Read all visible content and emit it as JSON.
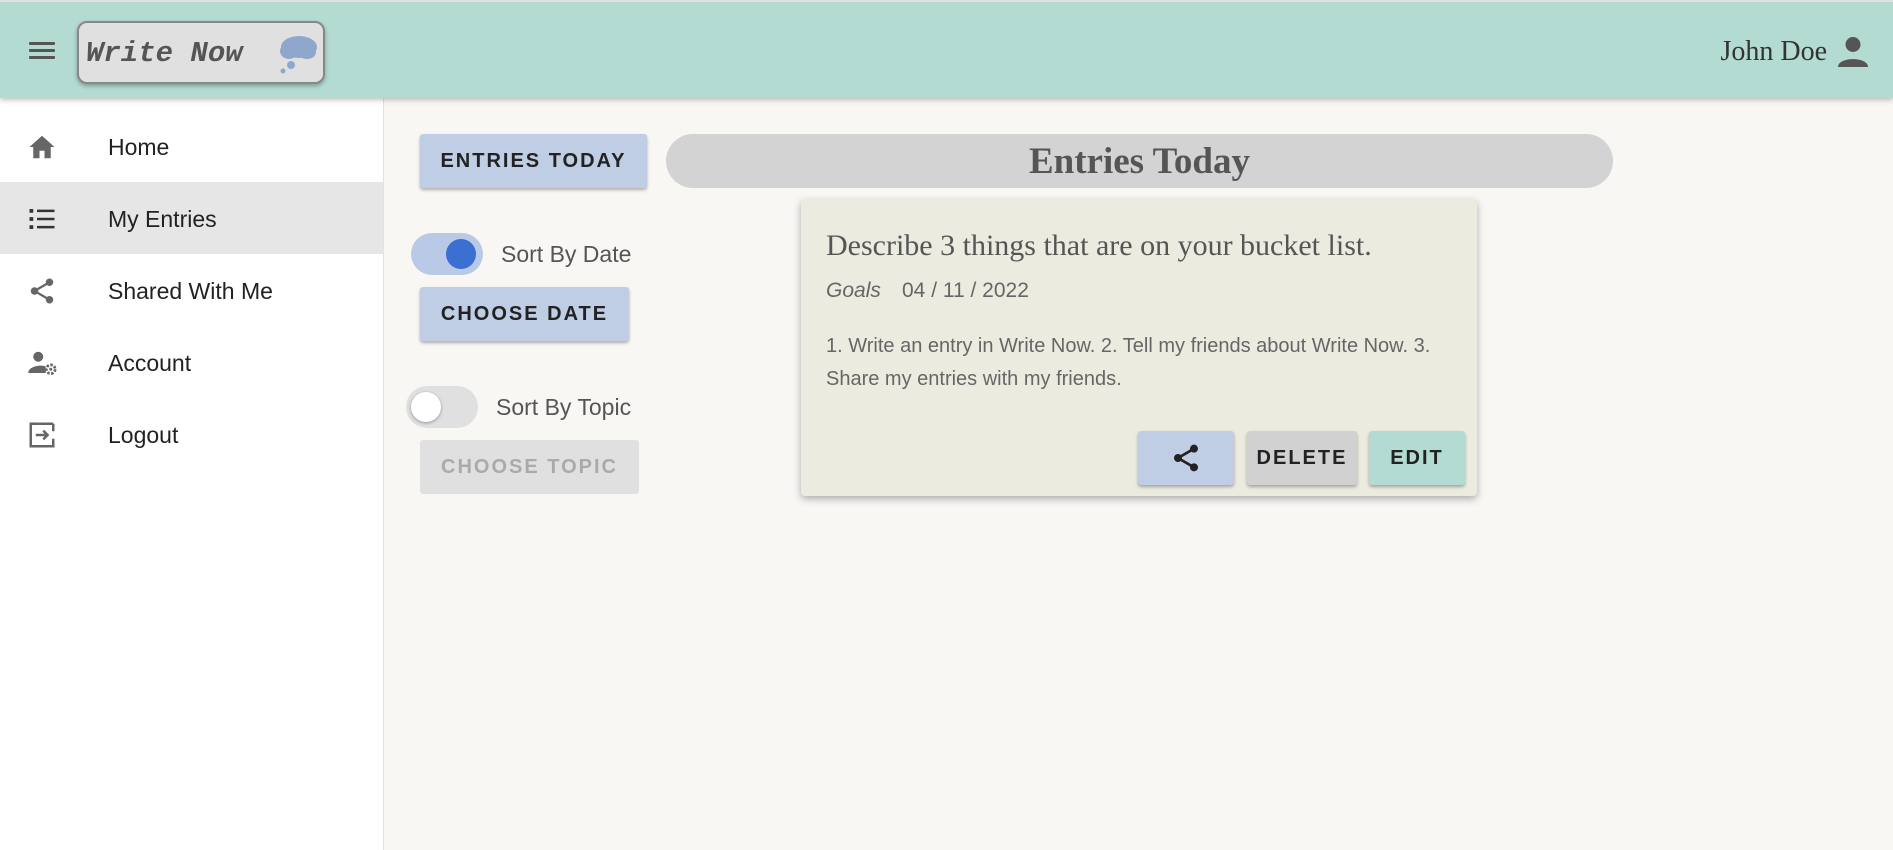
{
  "app": {
    "title": "Write Now",
    "user_name": "John Doe",
    "colors": {
      "header": "#b3dbd2",
      "accent_blue": "#3b6fd1",
      "button_blue": "#bfcde5",
      "card_bg": "#ecebe0"
    }
  },
  "sidebar": {
    "items": [
      {
        "label": "Home",
        "icon": "home-icon",
        "active": false
      },
      {
        "label": "My Entries",
        "icon": "list-icon",
        "active": true
      },
      {
        "label": "Shared With Me",
        "icon": "share-icon",
        "active": false
      },
      {
        "label": "Account",
        "icon": "account-settings-icon",
        "active": false
      },
      {
        "label": "Logout",
        "icon": "logout-icon",
        "active": false
      }
    ]
  },
  "main": {
    "entries_today_button": "ENTRIES TODAY",
    "heading": "Entries Today",
    "sort_by_date": {
      "label": "Sort By Date",
      "on": true
    },
    "choose_date_button": "CHOOSE DATE",
    "sort_by_topic": {
      "label": "Sort By Topic",
      "on": false
    },
    "choose_topic_button": "CHOOSE TOPIC"
  },
  "entry": {
    "prompt": "Describe 3 things that are on your bucket list.",
    "topic": "Goals",
    "date": "04 / 11 / 2022",
    "body": "1. Write an entry in Write Now. 2. Tell my friends about Write Now. 3. Share my entries with my friends.",
    "delete_label": "DELETE",
    "edit_label": "EDIT"
  }
}
